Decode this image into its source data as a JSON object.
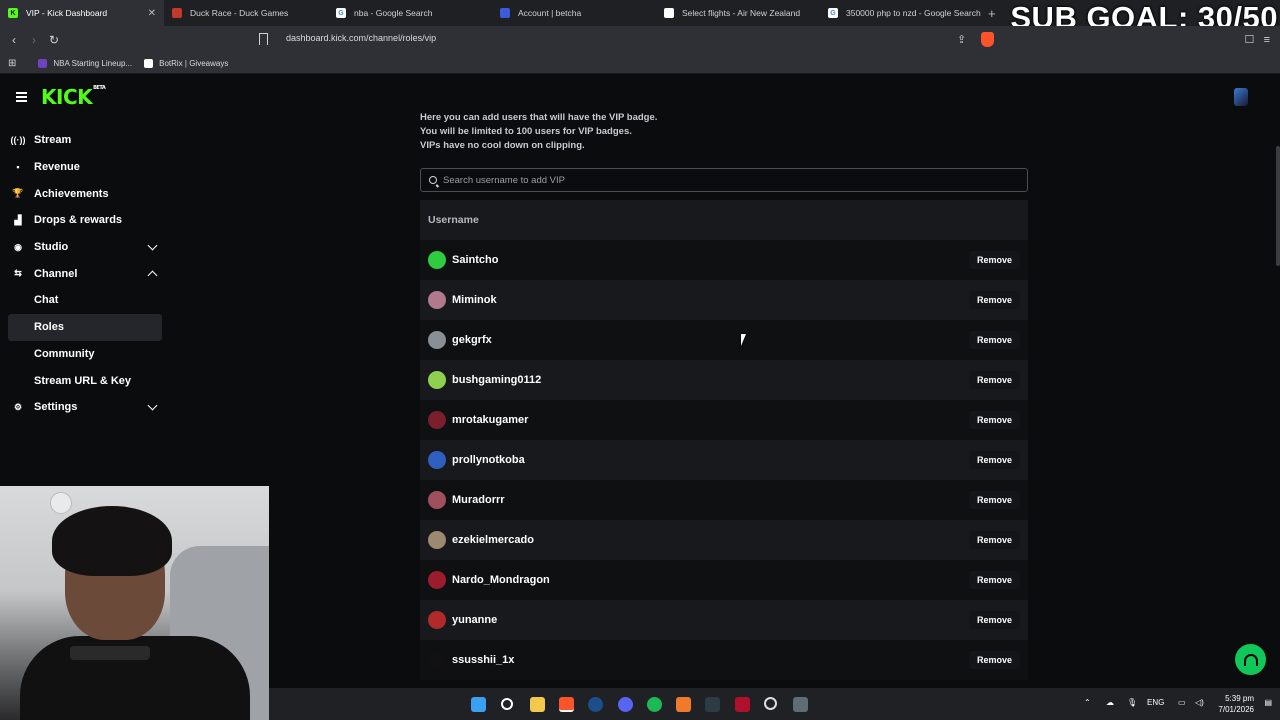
{
  "browser": {
    "tabs": [
      {
        "title": "VIP - Kick Dashboard",
        "active": true,
        "favicon_color": "#53fc18",
        "favicon_letter": "K"
      },
      {
        "title": "Duck Race - Duck Games",
        "active": false,
        "favicon_color": "#c0392b",
        "favicon_letter": ""
      },
      {
        "title": "nba - Google Search",
        "active": false,
        "favicon_color": "#ffffff",
        "favicon_letter": "G"
      },
      {
        "title": "Account | betcha",
        "active": false,
        "favicon_color": "#3b5bdb",
        "favicon_letter": ""
      },
      {
        "title": "Select flights - Air New Zealand",
        "active": false,
        "favicon_color": "#ffffff",
        "favicon_letter": ""
      },
      {
        "title": "350000 php to nzd - Google Search",
        "active": false,
        "favicon_color": "#ffffff",
        "favicon_letter": "G"
      }
    ],
    "new_tab": "+",
    "url": "dashboard.kick.com/channel/roles/vip",
    "bookmarks": [
      {
        "label": "NBA Starting Lineup...",
        "color": "#6f42c1"
      },
      {
        "label": "BotRix | Giveaways",
        "color": "#ffffff"
      }
    ]
  },
  "overlay": {
    "sub_goal": "SUB GOAL: 30/50"
  },
  "kick": {
    "logo": "KICK",
    "logo_badge": "BETA",
    "accent_color": "#53fc18",
    "nav": [
      {
        "label": "Stream",
        "icon": "broadcast-icon",
        "glyph": "((·))"
      },
      {
        "label": "Revenue",
        "icon": "wallet-icon",
        "glyph": "▪"
      },
      {
        "label": "Achievements",
        "icon": "trophy-icon",
        "glyph": "🏆"
      },
      {
        "label": "Drops & rewards",
        "icon": "chart-icon",
        "glyph": "▟"
      },
      {
        "label": "Studio",
        "icon": "camera-icon",
        "glyph": "◉"
      },
      {
        "label": "Channel",
        "icon": "channel-icon",
        "glyph": "⇆"
      },
      {
        "label": "Chat",
        "icon": "",
        "glyph": ""
      },
      {
        "label": "Roles",
        "icon": "",
        "glyph": ""
      },
      {
        "label": "Community",
        "icon": "",
        "glyph": ""
      },
      {
        "label": "Stream URL & Key",
        "icon": "",
        "glyph": ""
      },
      {
        "label": "Settings",
        "icon": "gear-icon",
        "glyph": "⚙"
      }
    ],
    "info_lines": [
      "Here you can add users that will have the VIP badge.",
      "You will be limited to 100 users for VIP badges.",
      "VIPs have no cool down on clipping."
    ],
    "search_placeholder": "Search username to add VIP",
    "table_header": "Username",
    "remove_label": "Remove",
    "vips": [
      {
        "name": "Saintcho",
        "avatar_color": "#2ecc40"
      },
      {
        "name": "Miminok",
        "avatar_color": "#b07a8c"
      },
      {
        "name": "gekgrfx",
        "avatar_color": "#8a8f96"
      },
      {
        "name": "bushgaming0112",
        "avatar_color": "#8fd14f"
      },
      {
        "name": "mrotakugamer",
        "avatar_color": "#7a1f2b"
      },
      {
        "name": "prollynotkoba",
        "avatar_color": "#2f5fbf"
      },
      {
        "name": "Muradorrr",
        "avatar_color": "#a0505a"
      },
      {
        "name": "ezekielmercado",
        "avatar_color": "#9c8a70"
      },
      {
        "name": "Nardo_Mondragon",
        "avatar_color": "#9b1c2c"
      },
      {
        "name": "yunanne",
        "avatar_color": "#b02a2a"
      },
      {
        "name": "ssusshii_1x",
        "avatar_color": "#111111"
      }
    ]
  },
  "taskbar": {
    "language": "ENG",
    "time": "5:39 pm",
    "date": "7/01/2026"
  }
}
